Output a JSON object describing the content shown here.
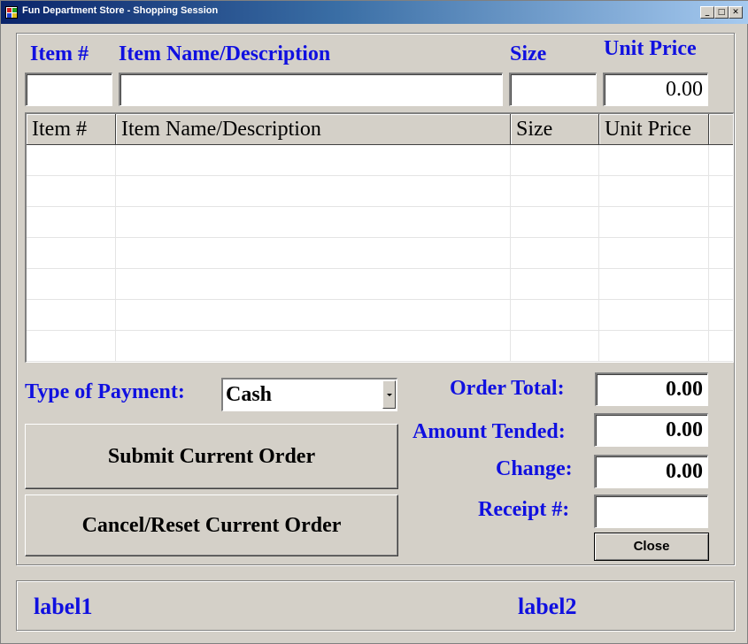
{
  "window": {
    "title": "Fun Department Store - Shopping Session",
    "minimize_glyph": "_",
    "maximize_glyph": "□",
    "close_glyph": "✕"
  },
  "item_entry": {
    "item_number_label": "Item #",
    "item_name_label": "Item Name/Description",
    "size_label": "Size",
    "unit_price_label": "Unit Price",
    "item_number_value": "",
    "item_name_value": "",
    "size_value": "",
    "unit_price_value": "0.00"
  },
  "grid": {
    "columns": [
      "Item #",
      "Item Name/Description",
      "Size",
      "Unit Price"
    ],
    "rows": [
      [
        "",
        "",
        "",
        ""
      ],
      [
        "",
        "",
        "",
        ""
      ],
      [
        "",
        "",
        "",
        ""
      ],
      [
        "",
        "",
        "",
        ""
      ],
      [
        "",
        "",
        "",
        ""
      ],
      [
        "",
        "",
        "",
        ""
      ],
      [
        "",
        "",
        "",
        ""
      ]
    ]
  },
  "payment": {
    "type_label": "Type of Payment:",
    "selected": "Cash"
  },
  "buttons": {
    "submit": "Submit Current Order",
    "cancel": "Cancel/Reset Current Order",
    "close": "Close"
  },
  "totals": {
    "order_total_label": "Order Total:",
    "order_total_value": "0.00",
    "amount_tended_label": "Amount Tended:",
    "amount_tended_value": "0.00",
    "change_label": "Change:",
    "change_value": "0.00",
    "receipt_label": "Receipt #:",
    "receipt_value": ""
  },
  "status": {
    "label1": "label1",
    "label2": "label2"
  },
  "colors": {
    "label_blue": "#1010e0",
    "form_background": "#d4d0c8",
    "titlebar_start": "#0a246a"
  }
}
